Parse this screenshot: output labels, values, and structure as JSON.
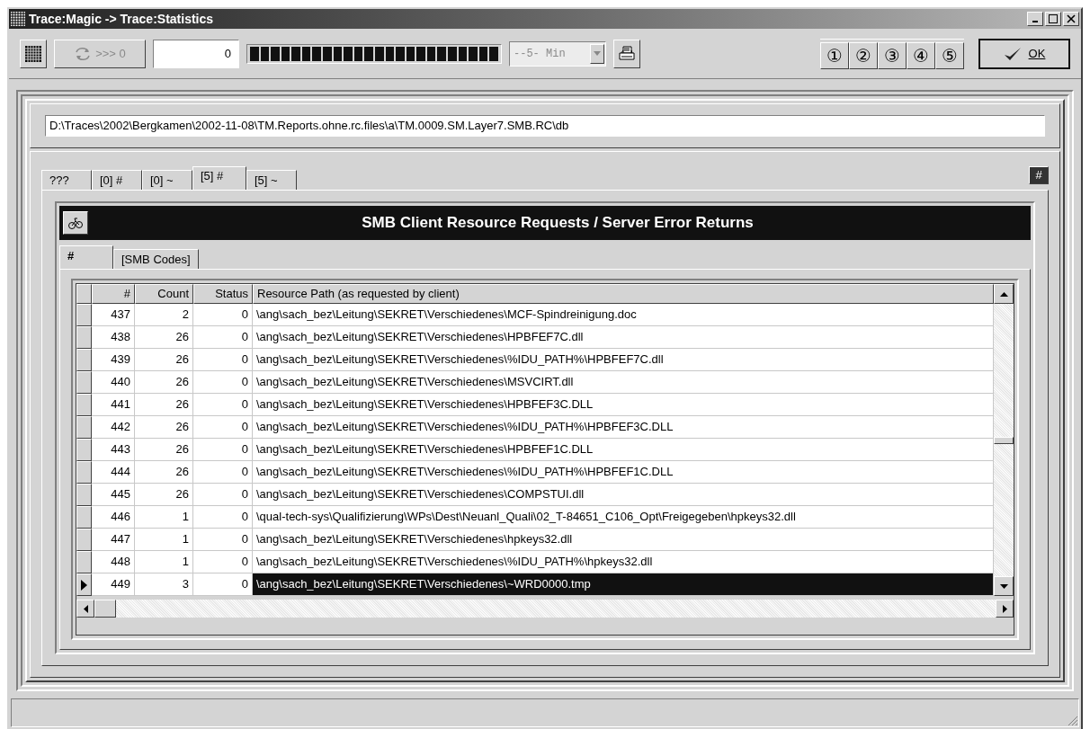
{
  "window": {
    "title": "Trace:Magic -> Trace:Statistics"
  },
  "toolbar": {
    "refresh_button": {
      "label": ">>> 0",
      "disabled": true
    },
    "counter": "0",
    "interval_dropdown": {
      "value": "--5- Min",
      "disabled": true
    },
    "slot_buttons": [
      "①",
      "②",
      "③",
      "④",
      "⑤"
    ],
    "ok_button": "OK"
  },
  "path_field": {
    "value": "D:\\Traces\\2002\\Bergkamen\\2002-11-08\\TM.Reports.ohne.rc.files\\a\\TM.0009.SM.Layer7.SMB.RC\\db"
  },
  "tabs": [
    {
      "label": "???",
      "selected": false
    },
    {
      "label": "[0] #",
      "selected": false
    },
    {
      "label": "[0] ~",
      "selected": false
    },
    {
      "label": "[5] #",
      "selected": true
    },
    {
      "label": "[5] ~",
      "selected": false
    }
  ],
  "corner_button": "#",
  "report": {
    "title": "SMB Client Resource Requests / Server Error Returns",
    "subtabs": [
      {
        "label": "#",
        "selected": true
      },
      {
        "label": "[SMB Codes]",
        "selected": false
      }
    ],
    "table": {
      "columns": [
        "#",
        "Count",
        "Status",
        "Resource Path (as requested by client)"
      ],
      "rows": [
        {
          "cells": [
            "437",
            "2",
            "0",
            "\\ang\\sach_bez\\Leitung\\SEKRET\\Verschiedenes\\MCF-Spindreinigung.doc"
          ],
          "selected": false
        },
        {
          "cells": [
            "438",
            "26",
            "0",
            "\\ang\\sach_bez\\Leitung\\SEKRET\\Verschiedenes\\HPBFEF7C.dll"
          ],
          "selected": false
        },
        {
          "cells": [
            "439",
            "26",
            "0",
            "\\ang\\sach_bez\\Leitung\\SEKRET\\Verschiedenes\\%IDU_PATH%\\HPBFEF7C.dll"
          ],
          "selected": false
        },
        {
          "cells": [
            "440",
            "26",
            "0",
            "\\ang\\sach_bez\\Leitung\\SEKRET\\Verschiedenes\\MSVCIRT.dll"
          ],
          "selected": false
        },
        {
          "cells": [
            "441",
            "26",
            "0",
            "\\ang\\sach_bez\\Leitung\\SEKRET\\Verschiedenes\\HPBFEF3C.DLL"
          ],
          "selected": false
        },
        {
          "cells": [
            "442",
            "26",
            "0",
            "\\ang\\sach_bez\\Leitung\\SEKRET\\Verschiedenes\\%IDU_PATH%\\HPBFEF3C.DLL"
          ],
          "selected": false
        },
        {
          "cells": [
            "443",
            "26",
            "0",
            "\\ang\\sach_bez\\Leitung\\SEKRET\\Verschiedenes\\HPBFEF1C.DLL"
          ],
          "selected": false
        },
        {
          "cells": [
            "444",
            "26",
            "0",
            "\\ang\\sach_bez\\Leitung\\SEKRET\\Verschiedenes\\%IDU_PATH%\\HPBFEF1C.DLL"
          ],
          "selected": false
        },
        {
          "cells": [
            "445",
            "26",
            "0",
            "\\ang\\sach_bez\\Leitung\\SEKRET\\Verschiedenes\\COMPSTUI.dll"
          ],
          "selected": false
        },
        {
          "cells": [
            "446",
            "1",
            "0",
            "\\qual-tech-sys\\Qualifizierung\\WPs\\Dest\\Neuanl_Quali\\02_T-84651_C106_Opt\\Freigegeben\\hpkeys32.dll"
          ],
          "selected": false
        },
        {
          "cells": [
            "447",
            "1",
            "0",
            "\\ang\\sach_bez\\Leitung\\SEKRET\\Verschiedenes\\hpkeys32.dll"
          ],
          "selected": false
        },
        {
          "cells": [
            "448",
            "1",
            "0",
            "\\ang\\sach_bez\\Leitung\\SEKRET\\Verschiedenes\\%IDU_PATH%\\hpkeys32.dll"
          ],
          "selected": false
        },
        {
          "cells": [
            "449",
            "3",
            "0",
            "\\ang\\sach_bez\\Leitung\\SEKRET\\Verschiedenes\\~WRD0000.tmp"
          ],
          "selected": true
        }
      ]
    }
  }
}
